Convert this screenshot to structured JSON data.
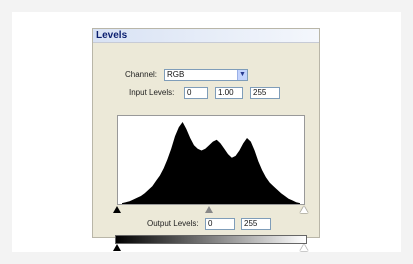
{
  "dialog": {
    "title": "Levels",
    "channel_label": "Channel:",
    "channel_value": "RGB",
    "input_levels_label": "Input Levels:",
    "input_levels": [
      "0",
      "1.00",
      "255"
    ],
    "output_levels_label": "Output Levels:",
    "output_levels": [
      "0",
      "255"
    ]
  },
  "histogram": {
    "fill_color": "#000000",
    "values": [
      1,
      2,
      3,
      5,
      7,
      9,
      12,
      16,
      20,
      26,
      32,
      40,
      50,
      62,
      76,
      86,
      92,
      84,
      74,
      66,
      62,
      60,
      62,
      66,
      70,
      72,
      68,
      62,
      56,
      52,
      54,
      60,
      68,
      74,
      70,
      60,
      48,
      38,
      30,
      24,
      20,
      16,
      12,
      9,
      6,
      4,
      2,
      1
    ]
  },
  "sliders": {
    "input_black": 0,
    "input_gamma": 1.0,
    "input_white": 255,
    "output_black": 0,
    "output_white": 255
  }
}
